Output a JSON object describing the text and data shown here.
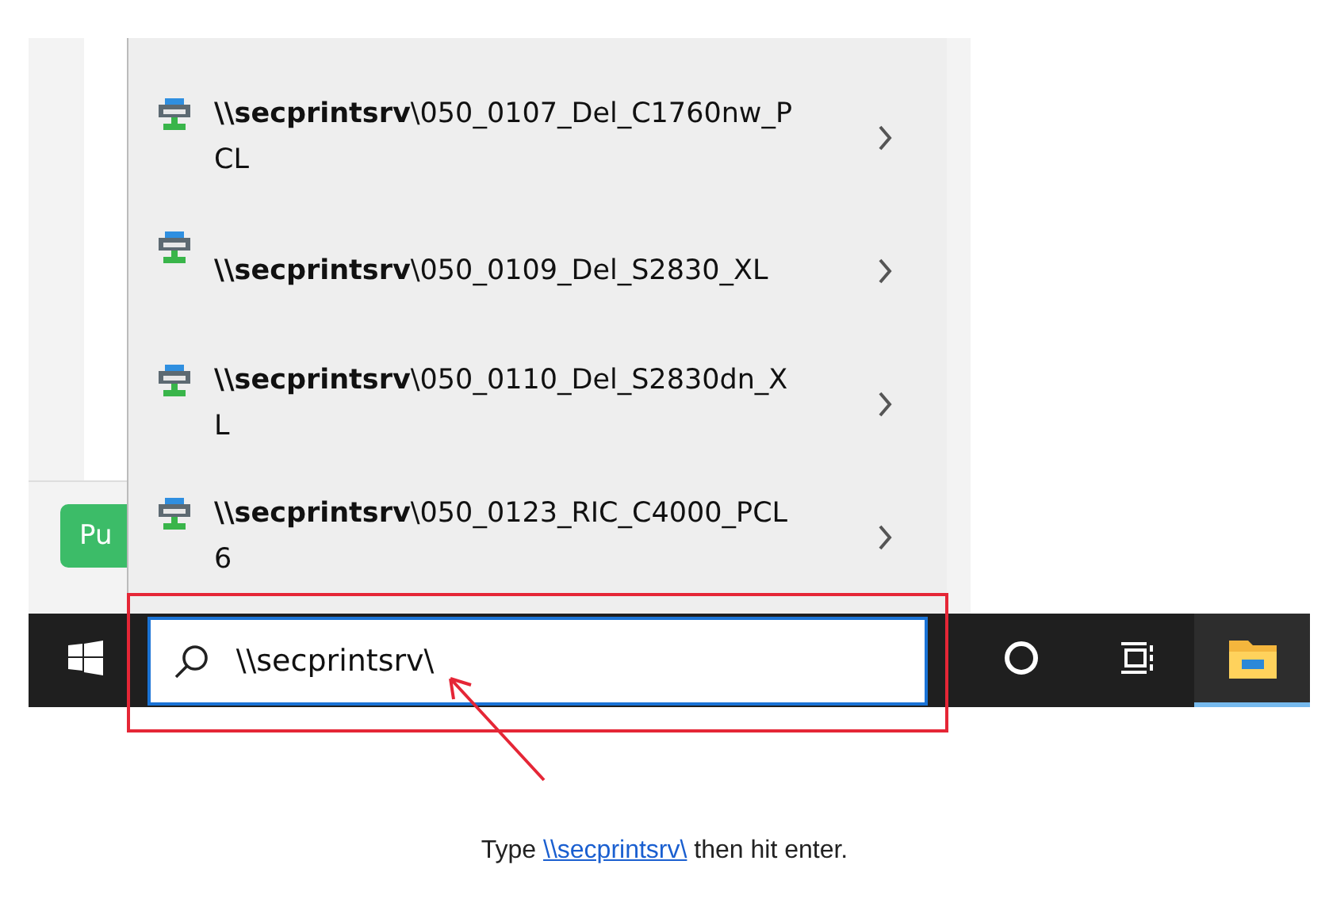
{
  "side_button": {
    "label": "Pu"
  },
  "printers": [
    {
      "name": "**\\\\secprintsrv**\\050_0107_Del_C1760nw_PCL"
    },
    {
      "name": "**\\\\secprintsrv**\\050_0109_Del_S2830_XL"
    },
    {
      "name": "**\\\\secprintsrv**\\050_0110_Del_S2830dn_XL"
    },
    {
      "name": "**\\\\secprintsrv**\\050_0123_RIC_C4000_PCL6"
    }
  ],
  "search": {
    "value": "\\\\secprintsrv\\"
  },
  "taskbar": [
    {
      "kind": "start"
    },
    {
      "kind": "search"
    },
    {
      "kind": "cortana"
    },
    {
      "kind": "taskview"
    },
    {
      "kind": "explorer",
      "selected": true
    }
  ],
  "caption": {
    "before": "Type ",
    "link": "\\\\secprintsrv\\",
    "after": " then hit enter."
  }
}
